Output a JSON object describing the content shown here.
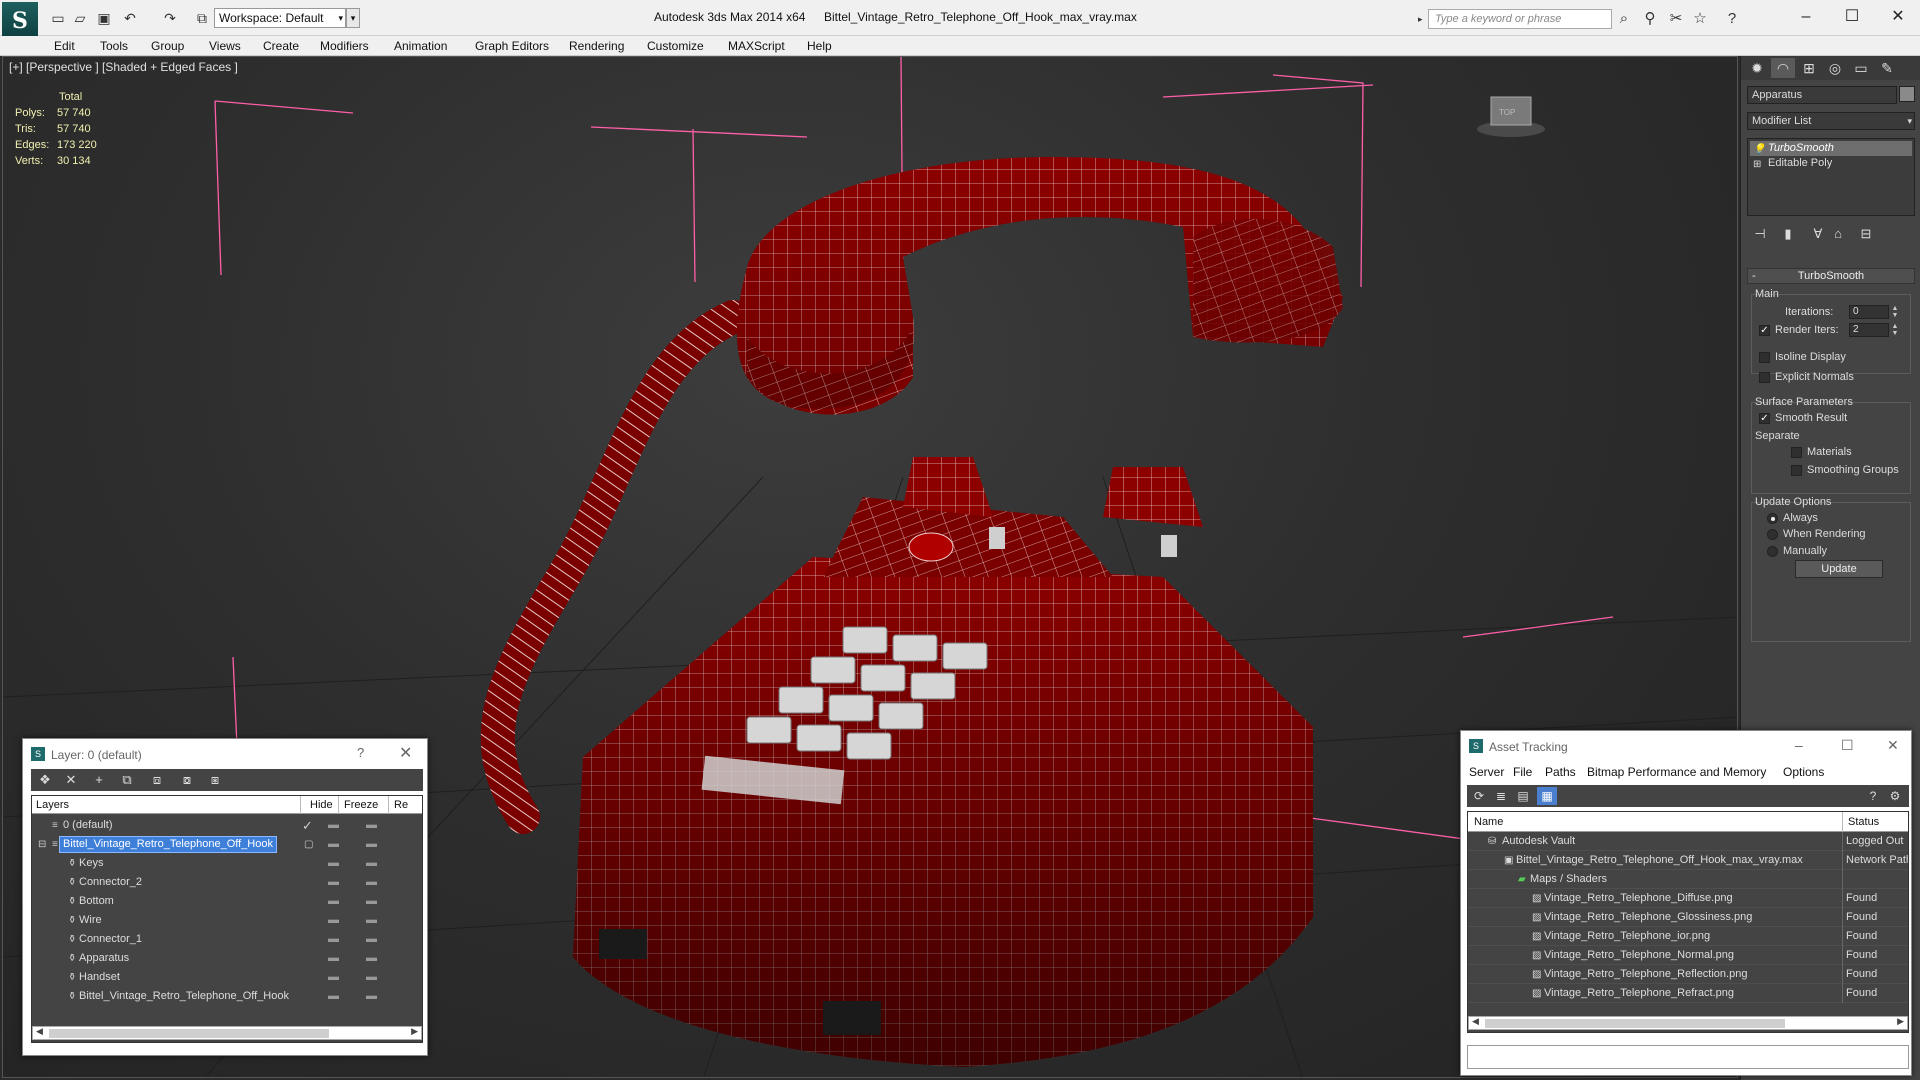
{
  "titlebar": {
    "app_name": "Autodesk 3ds Max  2014 x64",
    "file_name": "Bittel_Vintage_Retro_Telephone_Off_Hook_max_vray.max",
    "workspace": "Workspace: Default",
    "search_placeholder": "Type a keyword or phrase"
  },
  "menu": [
    "Edit",
    "Tools",
    "Group",
    "Views",
    "Create",
    "Modifiers",
    "Animation",
    "Graph Editors",
    "Rendering",
    "Customize",
    "MAXScript",
    "Help"
  ],
  "viewport": {
    "label": "[+] [Perspective ] [Shaded + Edged Faces ]",
    "stats": {
      "header": "Total",
      "rows": [
        {
          "k": "Polys:",
          "v": "57 740"
        },
        {
          "k": "Tris:",
          "v": "57 740"
        },
        {
          "k": "Edges:",
          "v": "173 220"
        },
        {
          "k": "Verts:",
          "v": "30 134"
        }
      ]
    },
    "colors": {
      "mesh": "#8c0000",
      "wire": "#f2d8d8",
      "helper": "#ff66aa"
    }
  },
  "command_panel": {
    "object_name": "Apparatus",
    "modifier_list": "Modifier List",
    "stack": [
      "TurboSmooth",
      "Editable Poly"
    ],
    "rollout_title": "TurboSmooth",
    "main": {
      "title": "Main",
      "iterations_label": "Iterations:",
      "iterations_value": "0",
      "render_iters_label": "Render Iters:",
      "render_iters_value": "2",
      "isoline": "Isoline Display",
      "explicit": "Explicit Normals"
    },
    "surface": {
      "title": "Surface Parameters",
      "smooth_result": "Smooth Result",
      "separate": "Separate",
      "materials": "Materials",
      "smoothing_groups": "Smoothing Groups"
    },
    "update": {
      "title": "Update Options",
      "always": "Always",
      "when_rendering": "When Rendering",
      "manually": "Manually",
      "button": "Update"
    }
  },
  "layer_window": {
    "title": "Layer: 0 (default)",
    "help": "?",
    "columns": [
      "Layers",
      "Hide",
      "Freeze",
      "Re"
    ],
    "rows": [
      {
        "name": "0 (default)",
        "level": 0
      },
      {
        "name": "Bittel_Vintage_Retro_Telephone_Off_Hook",
        "level": 0,
        "selected": true
      },
      {
        "name": "Keys",
        "level": 1
      },
      {
        "name": "Connector_2",
        "level": 1
      },
      {
        "name": "Bottom",
        "level": 1
      },
      {
        "name": "Wire",
        "level": 1
      },
      {
        "name": "Connector_1",
        "level": 1
      },
      {
        "name": "Apparatus",
        "level": 1
      },
      {
        "name": "Handset",
        "level": 1
      },
      {
        "name": "Bittel_Vintage_Retro_Telephone_Off_Hook",
        "level": 1
      }
    ]
  },
  "asset_window": {
    "title": "Asset Tracking",
    "menu": [
      "Server",
      "File",
      "Paths",
      "Bitmap Performance and Memory",
      "Options"
    ],
    "columns": [
      "Name",
      "Status"
    ],
    "rows": [
      {
        "name": "Autodesk Vault",
        "status": "Logged Out",
        "level": 0
      },
      {
        "name": "Bittel_Vintage_Retro_Telephone_Off_Hook_max_vray.max",
        "status": "Network Path",
        "level": 1
      },
      {
        "name": "Maps / Shaders",
        "status": "",
        "level": 2
      },
      {
        "name": "Vintage_Retro_Telephone_Diffuse.png",
        "status": "Found",
        "level": 3
      },
      {
        "name": "Vintage_Retro_Telephone_Glossiness.png",
        "status": "Found",
        "level": 3
      },
      {
        "name": "Vintage_Retro_Telephone_ior.png",
        "status": "Found",
        "level": 3
      },
      {
        "name": "Vintage_Retro_Telephone_Normal.png",
        "status": "Found",
        "level": 3
      },
      {
        "name": "Vintage_Retro_Telephone_Reflection.png",
        "status": "Found",
        "level": 3
      },
      {
        "name": "Vintage_Retro_Telephone_Refract.png",
        "status": "Found",
        "level": 3
      }
    ]
  }
}
